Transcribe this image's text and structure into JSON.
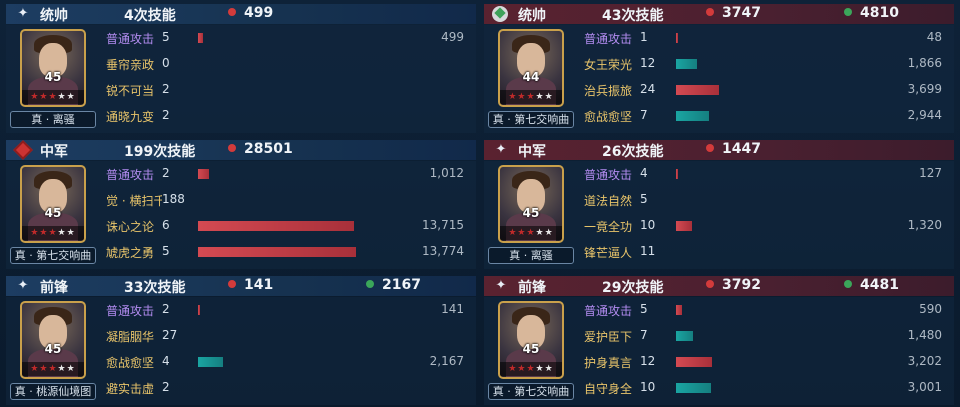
{
  "colors": {
    "accent_normal": "#b38cf0",
    "accent_gold": "#e8c46a",
    "damage_dot": "#d33b3b",
    "heal_dot": "#3ba65a",
    "damage_bar": "#c8424a",
    "heal_bar": "#1e9c9a",
    "ally_header": "#1d3d62",
    "enemy_header": "#5a2230"
  },
  "panels": [
    {
      "side": "ally",
      "role": "统帅",
      "role_icon": "sparkle-icon",
      "skills_text": "4次技能",
      "damage": "499",
      "heal": "",
      "hero": {
        "name": "真 · 离骚",
        "level": "45",
        "stars_red": 3,
        "stars_total": 5
      },
      "skills": [
        {
          "name": "普通攻击",
          "count": "5",
          "value": "499",
          "type": "damage",
          "fraction": 0.03
        },
        {
          "name": "垂帘亲政",
          "count": "0",
          "value": "",
          "type": "none",
          "fraction": 0
        },
        {
          "name": "锐不可当",
          "count": "2",
          "value": "",
          "type": "none",
          "fraction": 0
        },
        {
          "name": "通晓九变",
          "count": "2",
          "value": "",
          "type": "none",
          "fraction": 0
        }
      ]
    },
    {
      "side": "enemy",
      "role": "统帅",
      "role_icon": "rose-icon",
      "skills_text": "43次技能",
      "damage": "3747",
      "heal": "4810",
      "hero": {
        "name": "真 · 第七交响曲",
        "level": "44",
        "stars_red": 3,
        "stars_total": 5
      },
      "skills": [
        {
          "name": "普通攻击",
          "count": "1",
          "value": "48",
          "type": "damage",
          "fraction": 0.0
        },
        {
          "name": "女王荣光",
          "count": "12",
          "value": "1,866",
          "type": "heal",
          "fraction": 0.13
        },
        {
          "name": "治兵振旅",
          "count": "24",
          "value": "3,699",
          "type": "damage",
          "fraction": 0.27
        },
        {
          "name": "愈战愈坚",
          "count": "7",
          "value": "2,944",
          "type": "heal",
          "fraction": 0.21
        }
      ]
    },
    {
      "side": "ally",
      "role": "中军",
      "role_icon": "banner-icon",
      "skills_text": "199次技能",
      "damage": "28501",
      "heal": "",
      "hero": {
        "name": "真 · 第七交响曲",
        "level": "45",
        "stars_red": 3,
        "stars_total": 5
      },
      "skills": [
        {
          "name": "普通攻击",
          "count": "2",
          "value": "1,012",
          "type": "damage",
          "fraction": 0.07
        },
        {
          "name": "觉 · 横扫千...",
          "count": "188",
          "value": "",
          "type": "none",
          "fraction": 0
        },
        {
          "name": "诛心之论",
          "count": "6",
          "value": "13,715",
          "type": "damage",
          "fraction": 0.99
        },
        {
          "name": "虓虎之勇",
          "count": "5",
          "value": "13,774",
          "type": "damage",
          "fraction": 1.0
        }
      ]
    },
    {
      "side": "enemy",
      "role": "中军",
      "role_icon": "sparkle-icon",
      "skills_text": "26次技能",
      "damage": "1447",
      "heal": "",
      "hero": {
        "name": "真 · 离骚",
        "level": "45",
        "stars_red": 3,
        "stars_total": 5
      },
      "skills": [
        {
          "name": "普通攻击",
          "count": "4",
          "value": "127",
          "type": "damage",
          "fraction": 0.01
        },
        {
          "name": "道法自然",
          "count": "5",
          "value": "",
          "type": "none",
          "fraction": 0
        },
        {
          "name": "一竟全功",
          "count": "10",
          "value": "1,320",
          "type": "damage",
          "fraction": 0.1
        },
        {
          "name": "锋芒逼人",
          "count": "11",
          "value": "",
          "type": "none",
          "fraction": 0
        }
      ]
    },
    {
      "side": "ally",
      "role": "前锋",
      "role_icon": "sparkle-icon",
      "skills_text": "33次技能",
      "damage": "141",
      "heal": "2167",
      "hero": {
        "name": "真 · 桃源仙境图",
        "level": "45",
        "stars_red": 3,
        "stars_total": 5
      },
      "skills": [
        {
          "name": "普通攻击",
          "count": "2",
          "value": "141",
          "type": "damage",
          "fraction": 0.01
        },
        {
          "name": "凝脂胭华",
          "count": "27",
          "value": "",
          "type": "none",
          "fraction": 0
        },
        {
          "name": "愈战愈坚",
          "count": "4",
          "value": "2,167",
          "type": "heal",
          "fraction": 0.16
        },
        {
          "name": "避实击虚",
          "count": "2",
          "value": "",
          "type": "none",
          "fraction": 0
        }
      ]
    },
    {
      "side": "enemy",
      "role": "前锋",
      "role_icon": "sparkle-icon",
      "skills_text": "29次技能",
      "damage": "3792",
      "heal": "4481",
      "hero": {
        "name": "真 · 第七交响曲",
        "level": "45",
        "stars_red": 3,
        "stars_total": 5
      },
      "skills": [
        {
          "name": "普通攻击",
          "count": "5",
          "value": "590",
          "type": "damage",
          "fraction": 0.04
        },
        {
          "name": "爱护臣下",
          "count": "7",
          "value": "1,480",
          "type": "heal",
          "fraction": 0.11
        },
        {
          "name": "护身真言",
          "count": "12",
          "value": "3,202",
          "type": "damage",
          "fraction": 0.23
        },
        {
          "name": "自守身全",
          "count": "10",
          "value": "3,001",
          "type": "heal",
          "fraction": 0.22
        }
      ]
    }
  ]
}
